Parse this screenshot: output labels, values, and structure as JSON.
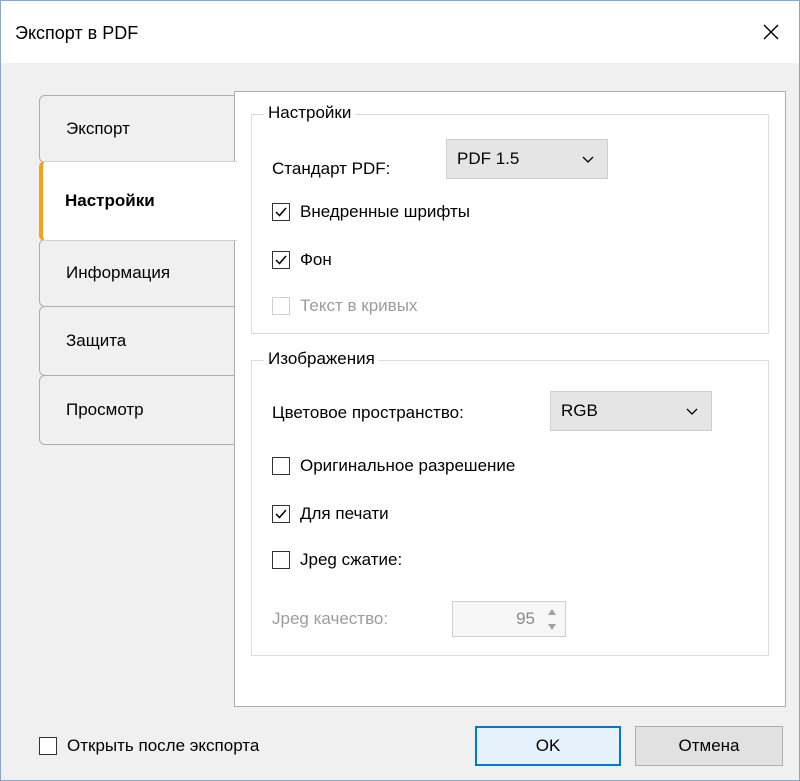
{
  "window": {
    "title": "Экспорт в PDF",
    "close_icon": "close-icon"
  },
  "tabs": [
    {
      "label": "Экспорт"
    },
    {
      "label": "Настройки"
    },
    {
      "label": "Информация"
    },
    {
      "label": "Защита"
    },
    {
      "label": "Просмотр"
    }
  ],
  "settings_group": {
    "legend": "Настройки",
    "pdf_standard_label": "Стандарт PDF:",
    "pdf_standard_value": "PDF 1.5",
    "embedded_fonts": {
      "label": "Внедренные шрифты",
      "checked": true
    },
    "background": {
      "label": "Фон",
      "checked": true
    },
    "text_curves": {
      "label": "Текст в кривых",
      "checked": false,
      "disabled": true
    }
  },
  "images_group": {
    "legend": "Изображения",
    "color_space_label": "Цветовое пространство:",
    "color_space_value": "RGB",
    "original_resolution": {
      "label": "Оригинальное разрешение",
      "checked": false
    },
    "for_print": {
      "label": "Для печати",
      "checked": true
    },
    "jpeg_compression": {
      "label": "Jpeg сжатие:",
      "checked": false
    },
    "jpeg_quality_label": "Jpeg качество:",
    "jpeg_quality_value": "95"
  },
  "footer": {
    "open_after_export": {
      "label": "Открыть после экспорта",
      "checked": false
    },
    "ok_label": "OK",
    "cancel_label": "Отмена"
  },
  "colors": {
    "accent": "#f7a11a",
    "default_button_border": "#0078d7"
  }
}
